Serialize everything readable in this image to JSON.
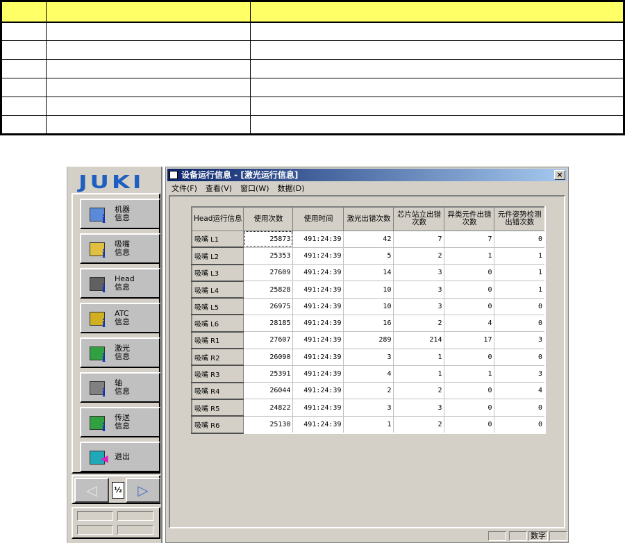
{
  "top_table": {
    "rows": 7,
    "cols": 3,
    "header_color": "#ffff66"
  },
  "logo": "JUKI",
  "buttons": [
    {
      "label": "机器\n信息",
      "icon": "machine-info-icon"
    },
    {
      "label": "吸嘴\n信息",
      "icon": "nozzle-info-icon"
    },
    {
      "label": "Head\n信息",
      "icon": "head-info-icon"
    },
    {
      "label": "ATC\n信息",
      "icon": "atc-info-icon"
    },
    {
      "label": "激光\n信息",
      "icon": "laser-info-icon"
    },
    {
      "label": "轴\n信息",
      "icon": "axis-info-icon"
    },
    {
      "label": "传送\n信息",
      "icon": "conveyor-info-icon"
    },
    {
      "label": "退出",
      "icon": "exit-door-icon"
    }
  ],
  "nav": {
    "prev": "◁",
    "next": "▷",
    "page": "½"
  },
  "window": {
    "title": "设备运行信息 - [激光运行信息]",
    "close": "×"
  },
  "menu": [
    "文件(F)",
    "查看(V)",
    "窗口(W)",
    "数据(D)"
  ],
  "grid": {
    "headers": [
      "Head运行信息",
      "使用次数",
      "使用时间",
      "激光出错次数",
      "芯片站立出错\n次数",
      "异类元件出错\n次数",
      "元件姿势检测\n出错次数"
    ],
    "rows": [
      [
        "吸嘴 L1",
        "25873",
        "491:24:39",
        "42",
        "7",
        "7",
        "0"
      ],
      [
        "吸嘴 L2",
        "25353",
        "491:24:39",
        "5",
        "2",
        "1",
        "1"
      ],
      [
        "吸嘴 L3",
        "27609",
        "491:24:39",
        "14",
        "3",
        "0",
        "1"
      ],
      [
        "吸嘴 L4",
        "25828",
        "491:24:39",
        "10",
        "3",
        "0",
        "1"
      ],
      [
        "吸嘴 L5",
        "26975",
        "491:24:39",
        "10",
        "3",
        "0",
        "0"
      ],
      [
        "吸嘴 L6",
        "28185",
        "491:24:39",
        "16",
        "2",
        "4",
        "0"
      ],
      [
        "吸嘴 R1",
        "27607",
        "491:24:39",
        "289",
        "214",
        "17",
        "3"
      ],
      [
        "吸嘴 R2",
        "26090",
        "491:24:39",
        "3",
        "1",
        "0",
        "0"
      ],
      [
        "吸嘴 R3",
        "25391",
        "491:24:39",
        "4",
        "1",
        "1",
        "3"
      ],
      [
        "吸嘴 R4",
        "26044",
        "491:24:39",
        "2",
        "2",
        "0",
        "4"
      ],
      [
        "吸嘴 R5",
        "24822",
        "491:24:39",
        "3",
        "3",
        "0",
        "0"
      ],
      [
        "吸嘴 R6",
        "25130",
        "491:24:39",
        "1",
        "2",
        "0",
        "0"
      ]
    ]
  },
  "status": {
    "num": "数字"
  }
}
